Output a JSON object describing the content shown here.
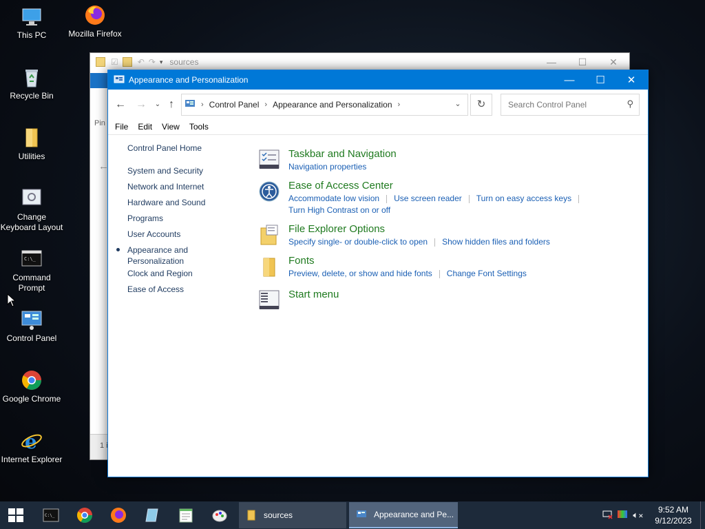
{
  "desktop": {
    "icons": [
      {
        "label": "This PC"
      },
      {
        "label": "Mozilla Firefox"
      },
      {
        "label": "Recycle Bin"
      },
      {
        "label": "Utilities"
      },
      {
        "label": "Change Keyboard Layout"
      },
      {
        "label": "Command Prompt"
      },
      {
        "label": "Control Panel"
      },
      {
        "label": "Google Chrome"
      },
      {
        "label": "Internet Explorer"
      }
    ]
  },
  "back_window": {
    "title": "sources",
    "side_text": "Pin",
    "status_text": "1 i"
  },
  "window": {
    "title": "Appearance and Personalization",
    "minimize": "—",
    "maximize": "☐",
    "close": "✕",
    "breadcrumb": [
      "Control Panel",
      "Appearance and Personalization"
    ],
    "search_placeholder": "Search Control Panel",
    "menu": [
      "File",
      "Edit",
      "View",
      "Tools"
    ]
  },
  "sidebar": {
    "home": "Control Panel Home",
    "items": [
      {
        "label": "System and Security"
      },
      {
        "label": "Network and Internet"
      },
      {
        "label": "Hardware and Sound"
      },
      {
        "label": "Programs"
      },
      {
        "label": "User Accounts"
      },
      {
        "label": "Appearance and Personalization",
        "current": true
      },
      {
        "label": "Clock and Region"
      },
      {
        "label": "Ease of Access"
      }
    ]
  },
  "categories": [
    {
      "title": "Taskbar and Navigation",
      "icon": "taskbar-icon",
      "links": [
        "Navigation properties"
      ]
    },
    {
      "title": "Ease of Access Center",
      "icon": "ease-of-access-icon",
      "links": [
        "Accommodate low vision",
        "Use screen reader",
        "Turn on easy access keys",
        "Turn High Contrast on or off"
      ]
    },
    {
      "title": "File Explorer Options",
      "icon": "folder-options-icon",
      "links": [
        "Specify single- or double-click to open",
        "Show hidden files and folders"
      ]
    },
    {
      "title": "Fonts",
      "icon": "fonts-folder-icon",
      "links": [
        "Preview, delete, or show and hide fonts",
        "Change Font Settings"
      ]
    },
    {
      "title": "Start menu",
      "icon": "start-menu-icon",
      "links": []
    }
  ],
  "taskbar": {
    "windows": [
      {
        "label": "sources"
      },
      {
        "label": "Appearance and Pe..."
      }
    ],
    "clock_time": "9:52 AM",
    "clock_date": "9/12/2023"
  },
  "colors": {
    "titlebar": "#0078d7",
    "category_heading": "#1f7a1f",
    "link": "#1a5fb4",
    "taskbar": "#1d2a3a"
  }
}
